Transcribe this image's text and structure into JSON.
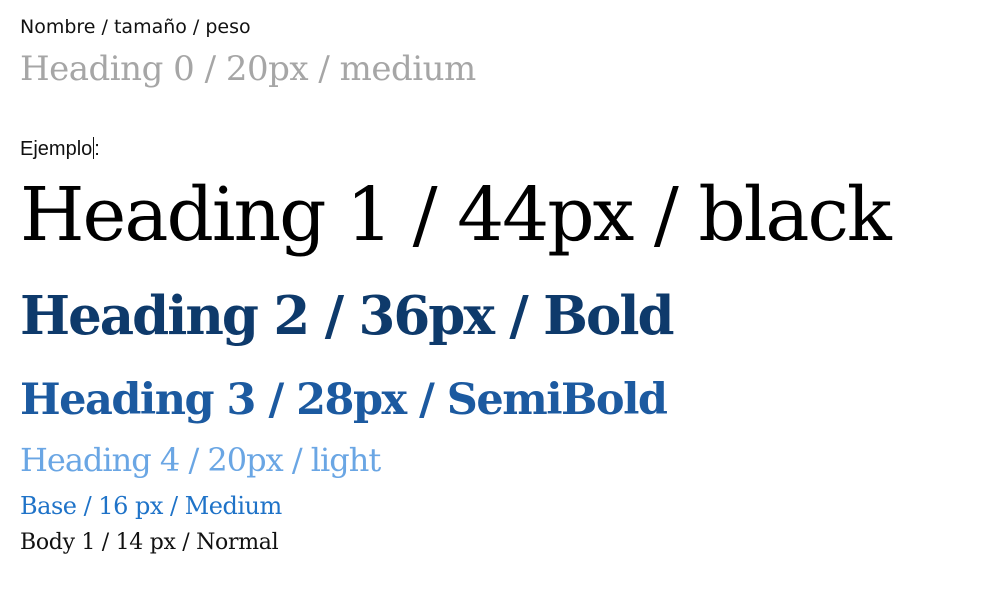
{
  "caption": "Nombre / tamaño / peso",
  "heading0": "Heading 0 / 20px / medium",
  "example_label": "Ejemplo",
  "example_colon": ":",
  "headings": {
    "h1": "Heading 1 / 44px / black",
    "h2": "Heading 2 / 36px / Bold",
    "h3": "Heading 3 / 28px / SemiBold",
    "h4": "Heading 4 / 20px / light",
    "base": "Base / 16 px / Medium",
    "body1": "Body 1 / 14 px / Normal"
  },
  "colors": {
    "heading0": "#a6a6a6",
    "h1": "#000000",
    "h2": "#0e3a6b",
    "h3": "#1c5aa0",
    "h4": "#6aa6e4",
    "base": "#1f73c8",
    "body1": "#111111"
  }
}
